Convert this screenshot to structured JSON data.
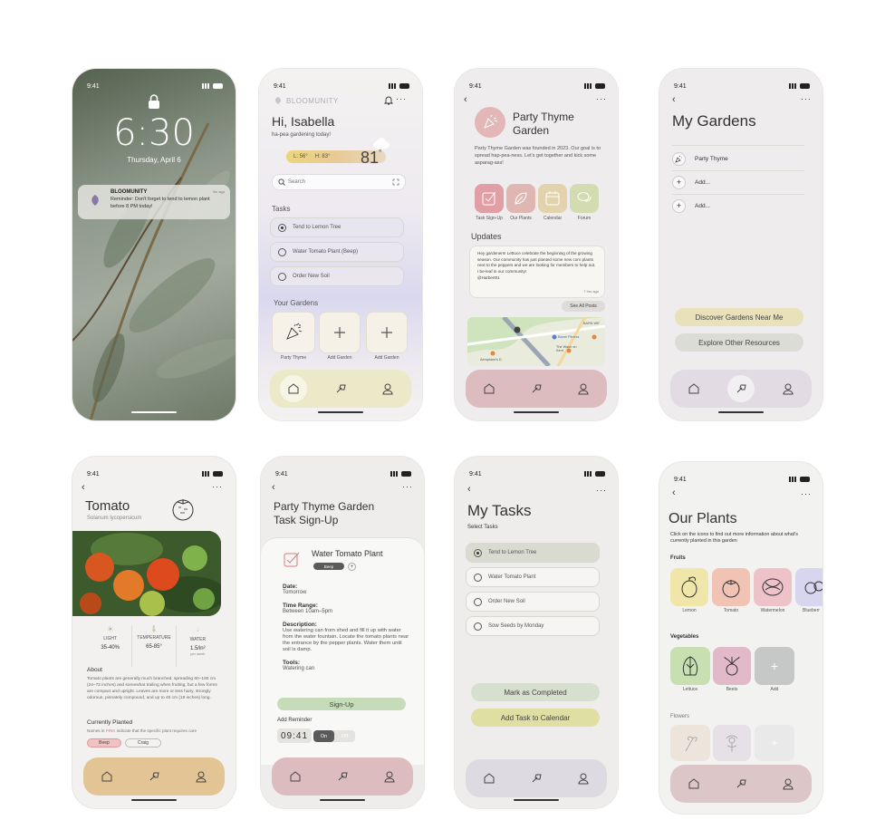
{
  "status_time": "9:41",
  "lock": {
    "time": "6:30",
    "date": "Thursday, April 6",
    "notif_app": "BLOOMUNITY",
    "notif_ago": "3m ago",
    "notif_text": "Reminder: Don't forget to tend to lemon plant before 8 PM today!"
  },
  "home": {
    "brand": "BLOOMUNITY",
    "greeting": "Hi, Isabella",
    "sub": "ha-pea gardening today!",
    "low": "L: 56°",
    "high": "H: 83°",
    "temp": "81",
    "deg": "°",
    "search": "Search",
    "tasks_title": "Tasks",
    "tasks": [
      "Tend to Lemon Tree",
      "Water Tomato Plant (Beep)",
      "Order New Soil"
    ],
    "gardens_title": "Your Gardens",
    "gardens": [
      "Party Thyme",
      "Add Garden",
      "Add Garden"
    ]
  },
  "garden": {
    "title_l1": "Party Thyme",
    "title_l2": "Garden",
    "desc": "Party Thyme Garden was founded in 2023. Our goal is to spread hap-pea-ness. Let's get together and kick some asparag-ass!",
    "actions": [
      "Task Sign-Up",
      "Our Plants",
      "Calendar",
      "Forum"
    ],
    "updates_title": "Updates",
    "update_text": "Hey gardeners! Lettuce celebrate the beginning of the growing season. Our community has just planted some new corn plants next to the peppers and we are looking for members to help out. I be-leaf in our community!",
    "update_user": "@Harbert01",
    "update_ago": "7 hrs ago",
    "see_all": "See All Posts",
    "map_labels": [
      "Barrel Fitness",
      "The Wash on Kent",
      "BARN WE",
      "Aeroplane's D"
    ]
  },
  "mygardens": {
    "title": "My Gardens",
    "items": [
      "Party Thyme",
      "Add...",
      "Add..."
    ],
    "btn1": "Discover Gardens Near Me",
    "btn2": "Explore Other Resources"
  },
  "tomato": {
    "name": "Tomato",
    "latin": "Solanum lycopersicum",
    "stats": [
      {
        "label": "LIGHT",
        "value": "35-40%",
        "note": ""
      },
      {
        "label": "TEMPERATURE",
        "value": "65-85°",
        "note": ""
      },
      {
        "label": "WATER",
        "value": "1.5/in²",
        "note": "per week"
      }
    ],
    "about_title": "About",
    "about": "Tomato plants are generally much branched, spreading 60–180 cm (24–72 inches) and somewhat trailing when fruiting, but a few forms are compact and upright. Leaves are more or less hairy, strongly odorous, pinnately compound, and up to 45 cm (18 inches) long.",
    "planted_title": "Currently Planted",
    "planted_note_a": "Names in",
    "planted_note_pink": "PINK",
    "planted_note_b": "indicate that the specific plant requires care",
    "names": [
      "Beep",
      "Craig"
    ]
  },
  "signup": {
    "title_l1": "Party Thyme Garden",
    "title_l2": "Task Sign-Up",
    "task": "Water Tomato Plant",
    "tag": "Beep",
    "date_l": "Date:",
    "date_v": "Tomorrow",
    "time_l": "Time Range:",
    "time_v": "Between 10am–5pm",
    "desc_l": "Description:",
    "desc_v": "Use watering can from shed and fill it up with water from the water fountain. Locate the tomato plants near the entrance by the pepper plants. Water them until soil is damp.",
    "tools_l": "Tools:",
    "tools_v": "Watering can",
    "btn": "Sign-Up",
    "reminder": "Add Reminder",
    "hh": "09",
    "colon": ":",
    "mm": "41",
    "on": "On",
    "off": "Off"
  },
  "mytasks": {
    "title": "My Tasks",
    "sub": "Select Tasks",
    "tasks": [
      "Tend to Lemon Tree",
      "Water Tomato Plant",
      "Order New Soil",
      "Sow Seeds by Monday"
    ],
    "btn1": "Mark as Completed",
    "btn2": "Add Task to Calendar"
  },
  "plants": {
    "title": "Our Plants",
    "sub": "Click on the icons to find out more information about what's currently planted in this garden",
    "fruits_title": "Fruits",
    "fruits": [
      "Lemon",
      "Tomato",
      "Watermelon",
      "Blueberr"
    ],
    "veg_title": "Vegetables",
    "veg": [
      "Lettuce",
      "Beets",
      "Add"
    ],
    "flowers_title": "Flowers"
  },
  "colors": {
    "accent_green": "#c6dcb8",
    "accent_pink": "#d9b3b5",
    "accent_yellow": "#e0dfa3",
    "nav_pink": "#dcbcbf",
    "nav_lavender": "#e3dbe3",
    "nav_tan": "#e3c595"
  }
}
